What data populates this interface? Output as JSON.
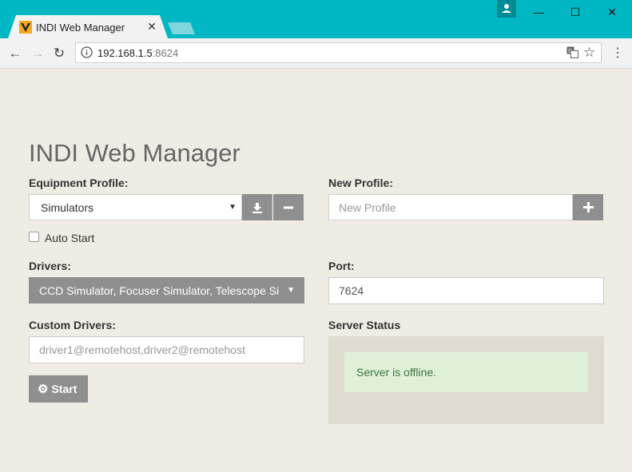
{
  "browser": {
    "tab_title": "INDI Web Manager",
    "url_host": "192.168.1.5",
    "url_port": ":8624"
  },
  "page": {
    "heading": "INDI Web Manager",
    "equipment_profile": {
      "label": "Equipment Profile:",
      "selected": "Simulators",
      "auto_start_label": "Auto Start",
      "auto_start_checked": false
    },
    "new_profile": {
      "label": "New Profile:",
      "placeholder": "New Profile"
    },
    "drivers": {
      "label": "Drivers:",
      "selected_text": "CCD Simulator, Focuser Simulator, Telescope Si"
    },
    "port": {
      "label": "Port:",
      "value": "7624"
    },
    "custom_drivers": {
      "label": "Custom Drivers:",
      "placeholder": "driver1@remotehost,driver2@remotehost"
    },
    "start_button": "Start",
    "server_status": {
      "label": "Server Status",
      "message": "Server is offline."
    }
  }
}
